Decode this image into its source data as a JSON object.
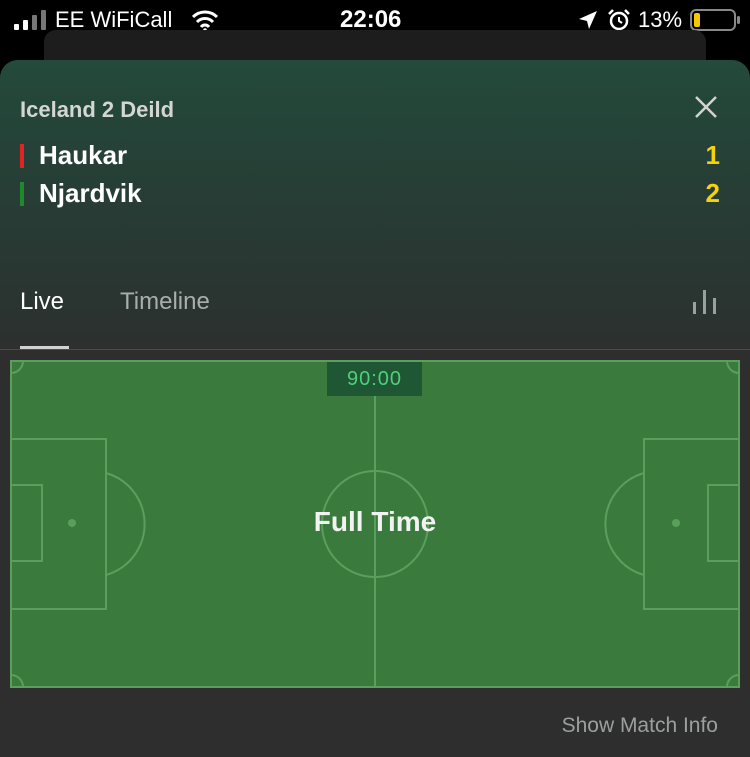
{
  "status_bar": {
    "carrier": "EE WiFiCall",
    "time": "22:06",
    "battery_percent": "13%",
    "icons": [
      "signal-icon",
      "wifi-icon",
      "location-arrow-icon",
      "alarm-icon",
      "battery-icon"
    ]
  },
  "match": {
    "league": "Iceland 2 Deild",
    "teams": [
      {
        "name": "Haukar",
        "score": "1",
        "color": "#e02424"
      },
      {
        "name": "Njardvik",
        "score": "2",
        "color": "#1e8a2e"
      }
    ]
  },
  "tabs": [
    {
      "label": "Live",
      "active": true
    },
    {
      "label": "Timeline",
      "active": false
    }
  ],
  "pitch": {
    "clock": "90:00",
    "status": "Full Time"
  },
  "footer": {
    "show_match_info": "Show Match Info"
  },
  "colors": {
    "score": "#f5d20a",
    "pitch": "#3a7a3c",
    "clock_text": "#4fd07a"
  }
}
